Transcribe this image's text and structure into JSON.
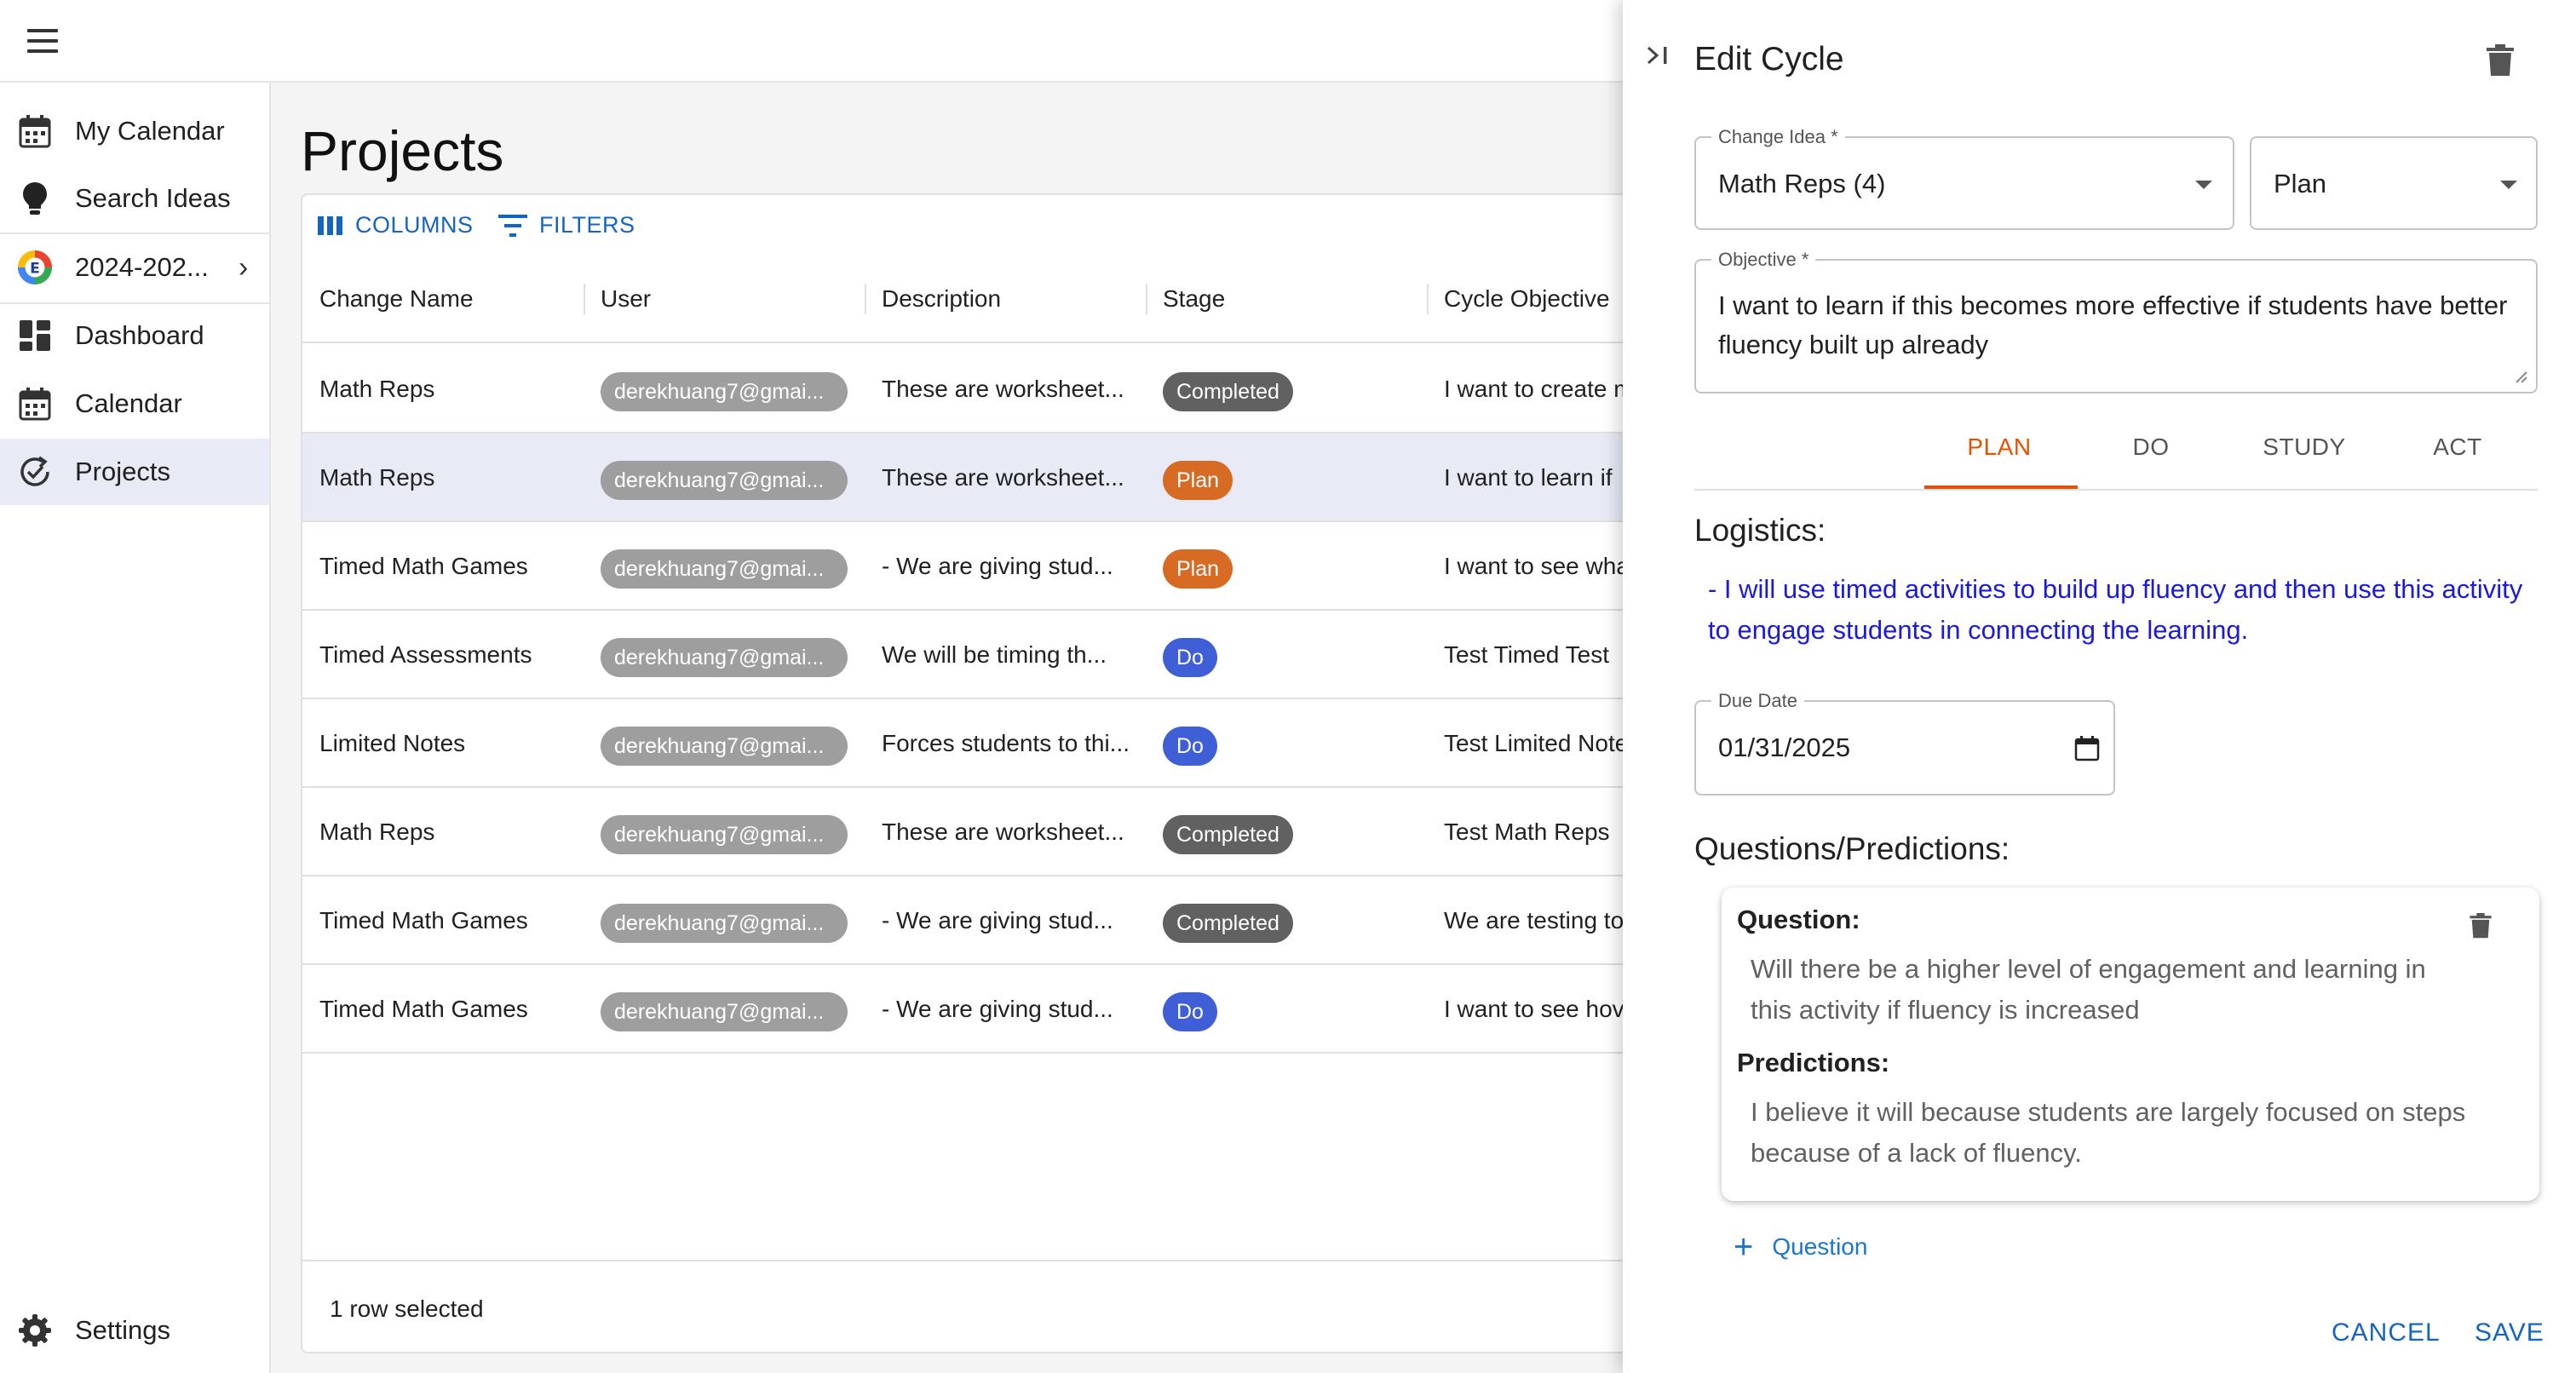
{
  "sidebar": {
    "items": [
      {
        "label": "My Calendar",
        "icon": "calendar-icon"
      },
      {
        "label": "Search Ideas",
        "icon": "lightbulb-icon"
      },
      {
        "label": "2024-202...",
        "icon": "school-logo-icon"
      },
      {
        "label": "Dashboard",
        "icon": "dashboard-icon"
      },
      {
        "label": "Calendar",
        "icon": "calendar-icon"
      },
      {
        "label": "Projects",
        "icon": "cycle-check-icon"
      }
    ],
    "settings_label": "Settings"
  },
  "main": {
    "title": "Projects",
    "toolbar": {
      "columns_label": "COLUMNS",
      "filters_label": "FILTERS"
    },
    "columns": [
      "Change Name",
      "User",
      "Description",
      "Stage",
      "Cycle Objective"
    ],
    "rows": [
      {
        "change_name": "Math Reps",
        "user": "derekhuang7@gmai...",
        "description": "These are worksheet...",
        "stage": "Completed",
        "objective": "I want to create m"
      },
      {
        "change_name": "Math Reps",
        "user": "derekhuang7@gmai...",
        "description": "These are worksheet...",
        "stage": "Plan",
        "objective": "I want to learn if"
      },
      {
        "change_name": "Timed Math Games",
        "user": "derekhuang7@gmai...",
        "description": "- We are giving stud...",
        "stage": "Plan",
        "objective": "I want to see wha"
      },
      {
        "change_name": "Timed Assessments",
        "user": "derekhuang7@gmai...",
        "description": "We will be timing th...",
        "stage": "Do",
        "objective": "Test Timed Test"
      },
      {
        "change_name": "Limited Notes",
        "user": "derekhuang7@gmai...",
        "description": "Forces students to thi...",
        "stage": "Do",
        "objective": "Test Limited Note"
      },
      {
        "change_name": "Math Reps",
        "user": "derekhuang7@gmai...",
        "description": "These are worksheet...",
        "stage": "Completed",
        "objective": "Test Math Reps"
      },
      {
        "change_name": "Timed Math Games",
        "user": "derekhuang7@gmai...",
        "description": "- We are giving stud...",
        "stage": "Completed",
        "objective": "We are testing to"
      },
      {
        "change_name": "Timed Math Games",
        "user": "derekhuang7@gmai...",
        "description": "- We are giving stud...",
        "stage": "Do",
        "objective": "I want to see hov"
      }
    ],
    "footer": "1 row selected"
  },
  "stage_colors": {
    "Completed": "#616161",
    "Plan": "#d86b24",
    "Do": "#3f5fd6"
  },
  "drawer": {
    "title": "Edit Cycle",
    "change_idea": {
      "label": "Change Idea *",
      "value": "Math Reps (4)"
    },
    "stage": {
      "value": "Plan"
    },
    "objective": {
      "label": "Objective *",
      "value": "I want to learn if this becomes more effective if students have better fluency built up already"
    },
    "tabs": [
      "PLAN",
      "DO",
      "STUDY",
      "ACT"
    ],
    "active_tab": "PLAN",
    "logistics_heading": "Logistics:",
    "logistics_text": "- I will use timed activities to build up fluency and then use this activity to engage students in connecting the learning.",
    "due_date": {
      "label": "Due Date",
      "value": "01/31/2025"
    },
    "questions_heading": "Questions/Predictions:",
    "question": {
      "question_label": "Question:",
      "question_text": "Will there be a higher level of engagement and learning in this activity if fluency is increased",
      "predictions_label": "Predictions:",
      "predictions_text": "I believe it will because students are largely focused on steps because of a lack of fluency."
    },
    "add_question_label": "Question",
    "cancel_label": "CANCEL",
    "save_label": "SAVE"
  },
  "colors": {
    "accent": "#1565c0",
    "active_tab": "#e65100",
    "selected_row": "#e8eaf6",
    "logistics_text": "#1a1adb"
  }
}
